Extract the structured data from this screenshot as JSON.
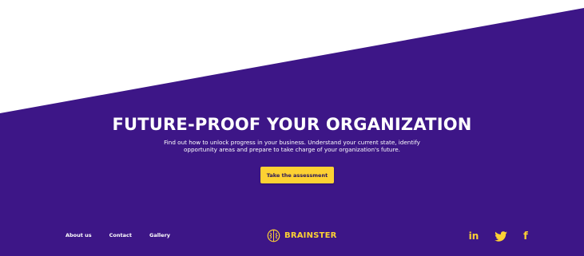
{
  "colors": {
    "background": "#ffffff",
    "hero": "#3d1687",
    "accent": "#fdd133",
    "text": "#ffffff"
  },
  "hero": {
    "title": "FUTURE-PROOF YOUR ORGANIZATION",
    "subtitle": "Find out how to unlock progress in your business. Understand your current state, identify opportunity areas and prepare to take charge of your organization's future.",
    "cta_label": "Take the assessment"
  },
  "footer": {
    "nav": [
      {
        "label": "About us"
      },
      {
        "label": "Contact"
      },
      {
        "label": "Gallery"
      }
    ],
    "brand": {
      "name": "BRAINSTER",
      "icon": "brain-logo-icon"
    },
    "social": [
      {
        "name": "linkedin",
        "icon": "linkedin-icon",
        "glyph": "in"
      },
      {
        "name": "twitter",
        "icon": "twitter-icon"
      },
      {
        "name": "facebook",
        "icon": "facebook-icon",
        "glyph": "f"
      }
    ]
  }
}
